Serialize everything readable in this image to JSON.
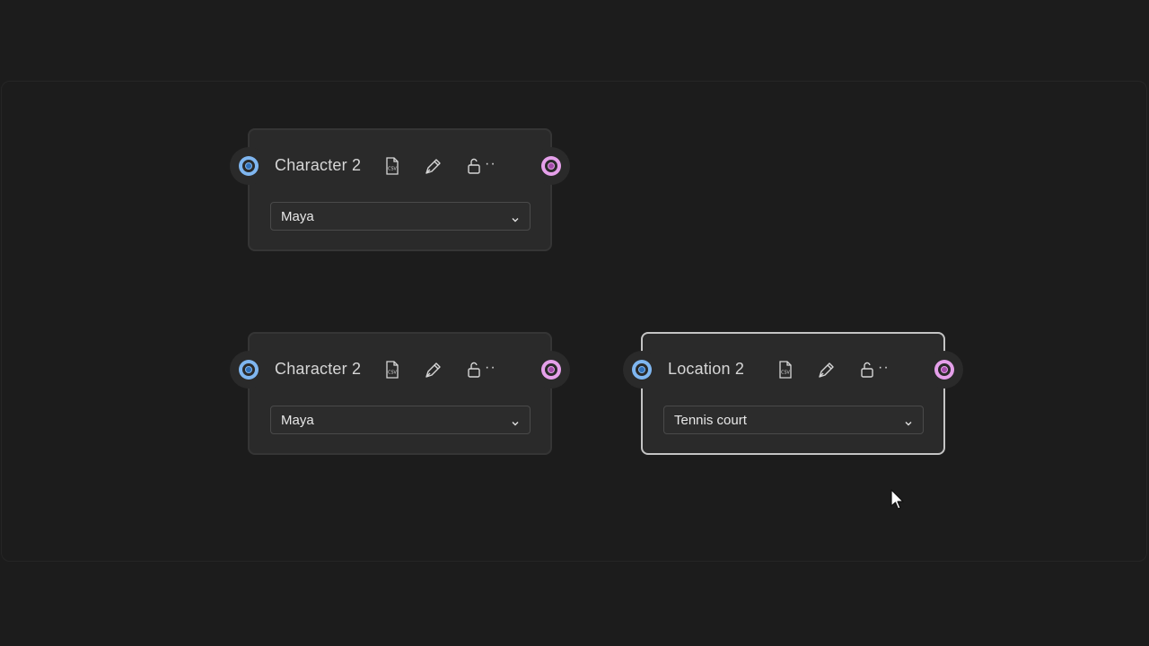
{
  "nodes": [
    {
      "title": "Character 2",
      "value": "Maya",
      "more": "··",
      "selected": false
    },
    {
      "title": "Character 2",
      "value": "Maya",
      "more": "··",
      "selected": false
    },
    {
      "title": "Location 2",
      "value": "Tennis court",
      "more": "··",
      "selected": true
    }
  ],
  "icons": {
    "csv": "csv-file-icon",
    "edit": "pen-icon",
    "lock": "unlock-icon",
    "dropdown": "chevron-down-icon",
    "cursor": "mouse-pointer-icon"
  },
  "colors": {
    "input_port": "#7fb6f0",
    "output_port": "#e5a0ea",
    "selected_border": "#c4c4c4",
    "background": "#1c1c1c"
  },
  "icon_labels": {
    "csv": "CSV"
  }
}
